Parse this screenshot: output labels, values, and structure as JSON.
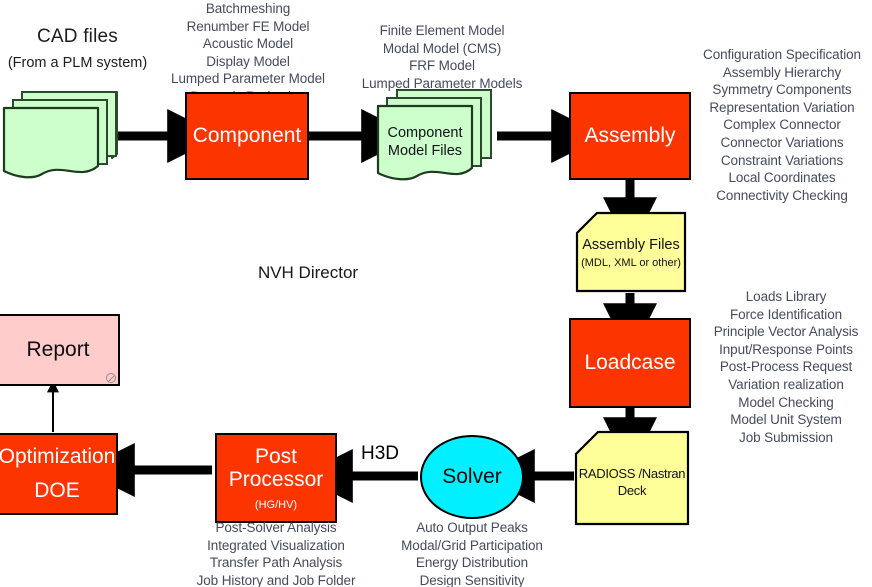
{
  "diagram": {
    "center_label": "NVH Director",
    "colors": {
      "process_red": "#FC3500",
      "doc_green": "#CCFFCC",
      "data_yellow": "#FFFF99",
      "report_pink": "#FFCCCC",
      "solver_cyan": "#00F0FF",
      "outline": "#000000",
      "annotation_text": "#464B5C"
    }
  },
  "cad": {
    "title": "CAD files",
    "subtitle": "(From a PLM system)"
  },
  "annotations": {
    "component": [
      "Batchmeshing",
      "Renumber FE Model",
      "Acoustic Model",
      "Display Model",
      "Lumped Parameter Model",
      "Dynamic Reduction"
    ],
    "component_files": [
      "Finite Element Model",
      "Modal Model (CMS)",
      "FRF Model",
      "Lumped Parameter Models"
    ],
    "assembly": [
      "Configuration Specification",
      "Assembly Hierarchy",
      "Symmetry Components",
      "Representation Variation",
      "Complex Connector",
      "Connector Variations",
      "Constraint Variations",
      "Local Coordinates",
      "Connectivity Checking"
    ],
    "loadcase": [
      "Loads Library",
      "Force Identification",
      "Principle Vector Analysis",
      "Input/Response Points",
      "Post-Process Request",
      "Variation realization",
      "Model Checking",
      "Model Unit System",
      "Job Submission"
    ],
    "post_processor": [
      "Post-Solver Analysis",
      "Integrated Visualization",
      "Transfer Path Analysis",
      "Job History and Job Folder"
    ],
    "solver": [
      "Auto Output Peaks",
      "Modal/Grid Participation",
      "Energy Distribution",
      "Design Sensitivity"
    ]
  },
  "nodes": {
    "component": {
      "title": "Component"
    },
    "component_files": {
      "line1": "Component",
      "line2": "Model Files"
    },
    "assembly": {
      "title": "Assembly"
    },
    "assembly_files": {
      "line1": "Assembly Files",
      "line2": "(MDL, XML or other)"
    },
    "loadcase": {
      "title": "Loadcase"
    },
    "deck": {
      "line1": "RADIOSS /Nastran",
      "line2": "Deck"
    },
    "solver": {
      "title": "Solver"
    },
    "post_processor": {
      "line1": "Post",
      "line2": "Processor",
      "sub": "(HG/HV)"
    },
    "optimization": {
      "line1": "Optimization",
      "line2": "DOE"
    },
    "report": {
      "title": "Report"
    }
  },
  "edges": {
    "h3d_label": "H3D"
  }
}
